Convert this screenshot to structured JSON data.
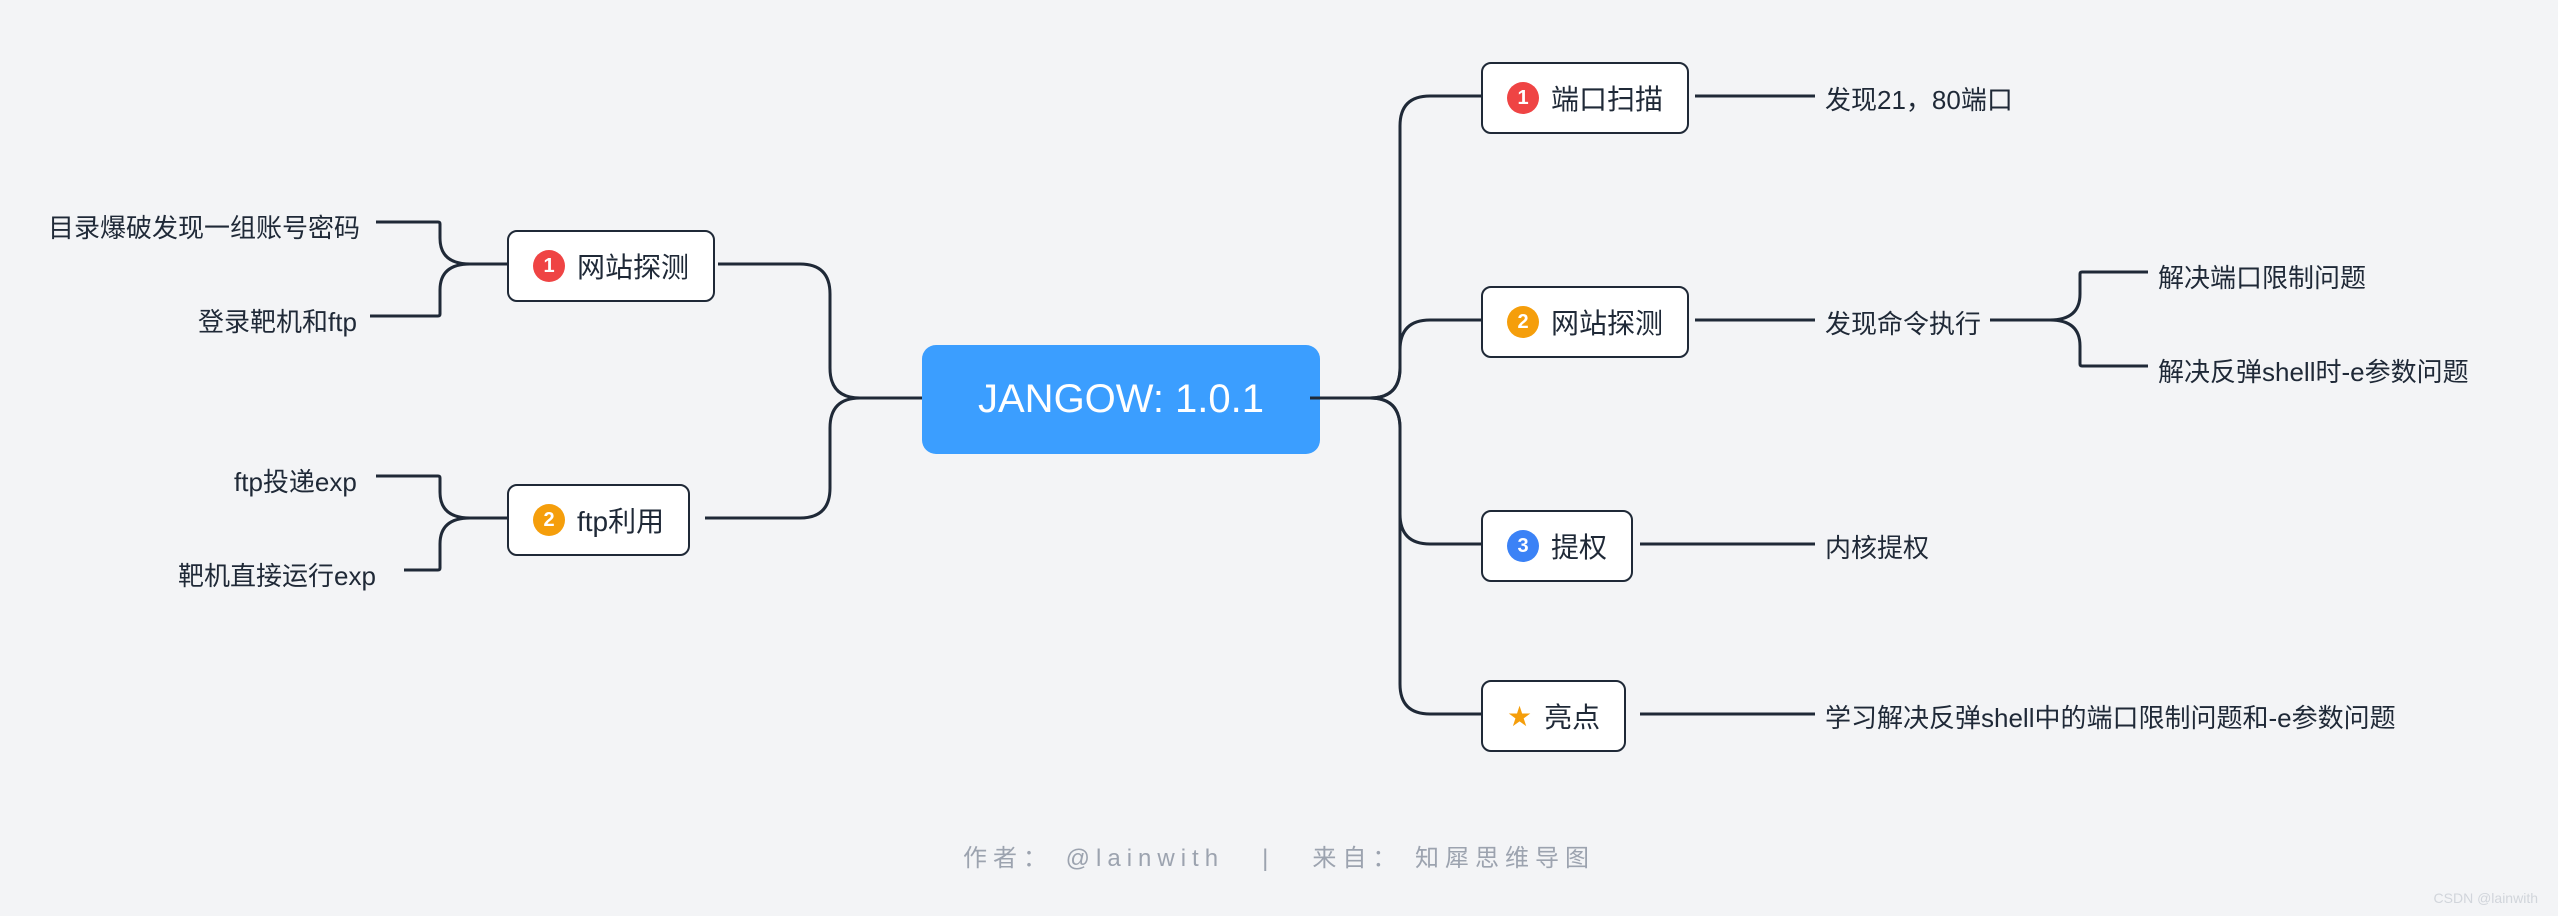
{
  "center": {
    "title": "JANGOW: 1.0.1"
  },
  "left": {
    "n1": {
      "num": "1",
      "label": "网站探测"
    },
    "n1_children": [
      "目录爆破发现一组账号密码",
      "登录靶机和ftp"
    ],
    "n2": {
      "num": "2",
      "label": "ftp利用"
    },
    "n2_children": [
      "ftp投递exp",
      "靶机直接运行exp"
    ]
  },
  "right": {
    "n1": {
      "num": "1",
      "label": "端口扫描",
      "child": "发现21，80端口"
    },
    "n2": {
      "num": "2",
      "label": "网站探测",
      "child": "发现命令执行",
      "grandchildren": [
        "解决端口限制问题",
        "解决反弹shell时-e参数问题"
      ]
    },
    "n3": {
      "num": "3",
      "label": "提权",
      "child": "内核提权"
    },
    "n4": {
      "label": "亮点",
      "child": "学习解决反弹shell中的端口限制问题和-e参数问题"
    }
  },
  "footer": {
    "author_label": "作者：",
    "author": "@lainwith",
    "sep": "|",
    "source_label": "来自：",
    "source": "知犀思维导图"
  },
  "watermark": "CSDN @lainwith"
}
